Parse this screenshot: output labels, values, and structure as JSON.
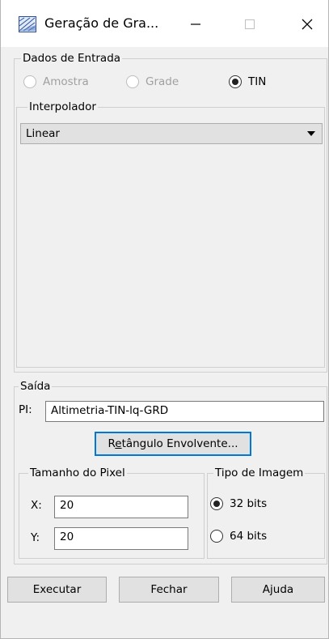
{
  "window": {
    "title": "Geração de Gra...",
    "minimize_glyph": "—",
    "maximize_glyph": "☐",
    "close_glyph": "✕"
  },
  "input": {
    "group_label": "Dados de Entrada",
    "radios": [
      {
        "label": "Amostra",
        "selected": false,
        "enabled": false
      },
      {
        "label": "Grade",
        "selected": false,
        "enabled": false
      },
      {
        "label": "TIN",
        "selected": true,
        "enabled": true
      }
    ],
    "interpolator": {
      "group_label": "Interpolador",
      "selected": "Linear"
    }
  },
  "output": {
    "group_label": "Saída",
    "pi_label": "PI:",
    "pi_value": "Altimetria-TIN-lq-GRD",
    "bbox_button_pre": "R",
    "bbox_button_ul": "e",
    "bbox_button_post": "tângulo Envolvente...",
    "pixel_size": {
      "group_label": "Tamanho do Pixel",
      "x_label": "X:",
      "x_value": "20",
      "y_label": "Y:",
      "y_value": "20"
    },
    "image_type": {
      "group_label": "Tipo de Imagem",
      "options": [
        {
          "label": "32 bits",
          "selected": true
        },
        {
          "label": "64 bits",
          "selected": false
        }
      ]
    }
  },
  "footer": {
    "execute": "Executar",
    "close": "Fechar",
    "help": "Ajuda"
  }
}
